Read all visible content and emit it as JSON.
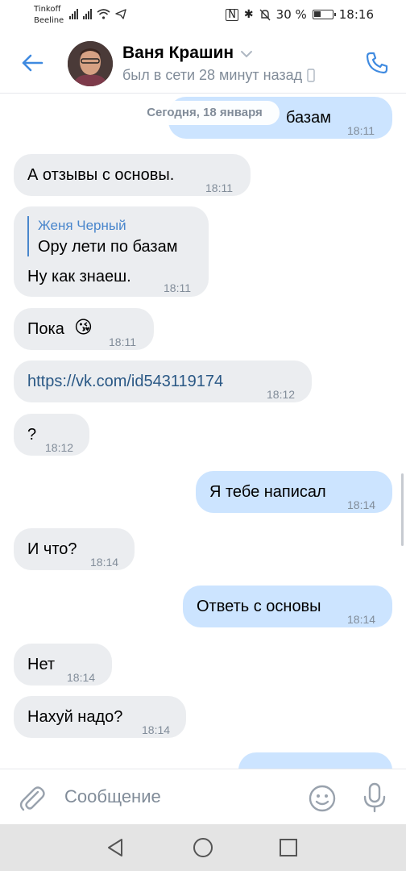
{
  "status_bar": {
    "carrier_1": "Tinkoff",
    "carrier_2": "Beeline",
    "battery": "30 %",
    "time": "18:16"
  },
  "header": {
    "name": "Ваня Крашин",
    "last_seen": "был в сети 28 минут назад"
  },
  "chat": {
    "date_separator": "Сегодня, 18 января",
    "messages": [
      {
        "direction": "out",
        "text": "базам",
        "time": "18:11"
      },
      {
        "direction": "in",
        "text": "А отзывы с основы.",
        "time": "18:11"
      },
      {
        "direction": "in",
        "reply_author": "Женя Черный",
        "reply_text": "Ору лети по базам",
        "text": "Ну как знаеш.",
        "time": "18:11"
      },
      {
        "direction": "in",
        "text": "Пока",
        "emoji": "😘",
        "time": "18:11"
      },
      {
        "direction": "in",
        "text": "https://vk.com/id543119174",
        "time": "18:12"
      },
      {
        "direction": "in",
        "text": "?",
        "time": "18:12"
      },
      {
        "direction": "out",
        "text": "Я тебе написал",
        "time": "18:14"
      },
      {
        "direction": "in",
        "text": "И что?",
        "time": "18:14"
      },
      {
        "direction": "out",
        "text": "Ответь с основы",
        "time": "18:14"
      },
      {
        "direction": "in",
        "text": "Нет",
        "time": "18:14"
      },
      {
        "direction": "in",
        "text": "Нахуй надо?",
        "time": "18:14"
      }
    ]
  },
  "composer": {
    "placeholder": "Сообщение"
  },
  "colors": {
    "accent": "#3f8ae0",
    "incoming_bubble": "#ebedf0",
    "outgoing_bubble": "#cce4ff",
    "link": "#2a5885",
    "secondary_text": "#818c99"
  },
  "icons": [
    "back-arrow-icon",
    "chevron-down-icon",
    "phone-icon",
    "mobile-icon",
    "paperclip-icon",
    "smile-icon",
    "microphone-icon",
    "nav-back-icon",
    "nav-home-icon",
    "nav-recents-icon"
  ]
}
